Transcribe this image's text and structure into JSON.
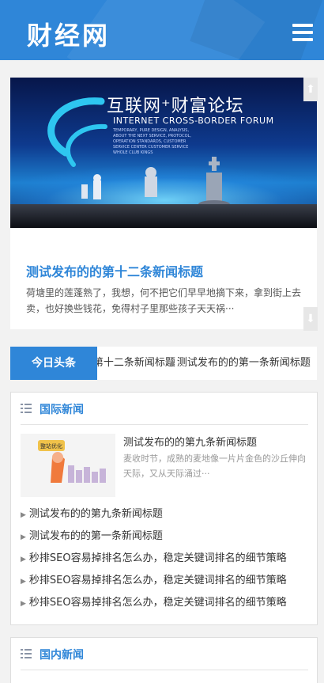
{
  "header": {
    "logo": "财经网",
    "menu_icon": "hamburger-menu-icon",
    "bg_color": "#2f86d8"
  },
  "slider": {
    "banner": {
      "title": "互联网⁺财富论坛",
      "subtitle": "INTERNET CROSS-BORDER FORUM",
      "small_text": "TEMPORARY, PURE DESIGN, ANALYSIS, ABOUT THE NEXT SERVICE, PROTOCOL, OPERATION STANDARDS, CUSTOMER SERVICE CENTER CUSTOMER SERVICE WHOLE CLUB KINGS"
    },
    "title": "测试发布的的第十二条新闻标题",
    "description": "荷塘里的莲蓬熟了，我想，何不把它们早早地摘下来，拿到街上去卖，也好换些钱花，免得村子里那些孩子天天祸···",
    "prev_icon": "arrow-up-icon",
    "next_icon": "arrow-down-icon"
  },
  "ticker": {
    "label": "今日头条",
    "items": [
      "测试发布的的第十二条新闻标题",
      "测试发布的的第一条新闻标题"
    ]
  },
  "international": {
    "title": "国际新闻",
    "icon": "list-icon",
    "featured": {
      "title": "测试发布的的第九条新闻标题",
      "description": "麦收时节，成熟的麦地像一片片金色的沙丘伸向天际，又从天际涌过···",
      "thumb_badge": "整站优化"
    },
    "items": [
      "测试发布的的第九条新闻标题",
      "测试发布的的第一条新闻标题",
      "秒排SEO容易掉排名怎么办，稳定关键词排名的细节策略",
      "秒排SEO容易掉排名怎么办，稳定关键词排名的细节策略",
      "秒排SEO容易掉排名怎么办，稳定关键词排名的细节策略"
    ]
  },
  "domestic": {
    "title": "国内新闻",
    "icon": "list-icon"
  }
}
